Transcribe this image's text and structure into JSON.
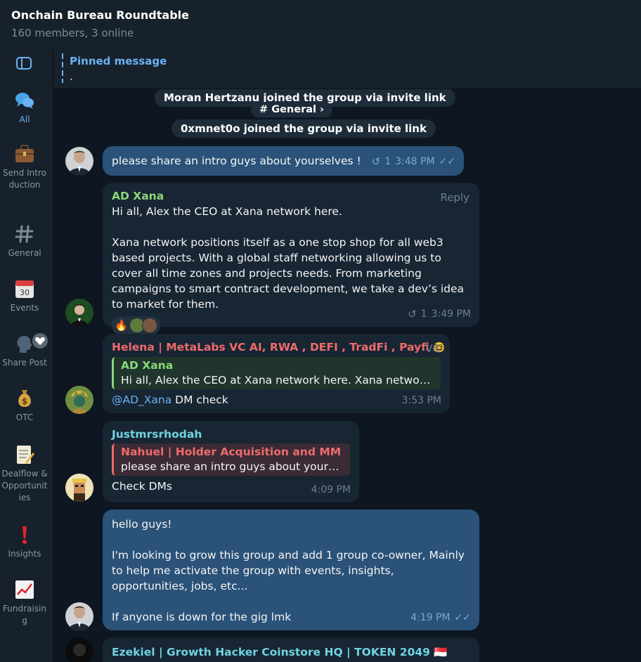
{
  "header": {
    "title": "Onchain Bureau Roundtable",
    "subtitle": "160 members, 3 online"
  },
  "sidebar": {
    "items": [
      {
        "label": "All",
        "icon": "chat-bubbles-icon"
      },
      {
        "label": "Send Introduction",
        "icon": "briefcase-icon"
      },
      {
        "label": "General",
        "icon": "hash-icon"
      },
      {
        "label": "Events",
        "icon": "calendar-icon"
      },
      {
        "label": "Share Post",
        "icon": "speaking-head-icon"
      },
      {
        "label": "OTC",
        "icon": "money-bag-icon"
      },
      {
        "label": "Dealflow & Opportunities",
        "icon": "memo-icon"
      },
      {
        "label": "Insights",
        "icon": "exclamation-icon"
      },
      {
        "label": "Fundraising",
        "icon": "chart-increasing-icon"
      }
    ]
  },
  "pinned": {
    "title": "Pinned message",
    "text": "."
  },
  "service": {
    "join1": "Moran Hertzanu joined the group via invite link",
    "topic": "# General ›",
    "join2": "0xmnet0o joined the group via invite link"
  },
  "messages": {
    "m1": {
      "text": "please share an intro guys about yourselves !",
      "replies": "1",
      "time": "3:48 PM"
    },
    "m2": {
      "sender": "AD Xana",
      "reply_label": "Reply",
      "line1": "Hi all, Alex the CEO at Xana network here.",
      "line2": "Xana network positions itself as a one stop shop for all web3 based projects. With a global staff networking allowing us to cover all time zones and projects needs. From marketing campaigns to smart contract development, we take a dev’s idea to market for them.",
      "reaction": "🔥",
      "replies": "1",
      "time": "3:49 PM"
    },
    "m3": {
      "sender": "Helena | MetaLabs VC AI, RWA , DEFI , TradFi , Payfi",
      "sender_emoji": "🤓",
      "tag": "VC",
      "quote_name": "AD Xana",
      "quote_text": "Hi all, Alex the CEO at Xana network here.   Xana network …",
      "mention": "@AD_Xana",
      "text": " DM check",
      "time": "3:53 PM"
    },
    "m4": {
      "sender": "Justmrsrhodah",
      "quote_name": "Nahuel | Holder Acquisition and MM",
      "quote_text": "please share an intro guys about yourse…",
      "text": "Check DMs",
      "time": "4:09 PM"
    },
    "m5": {
      "p1": "hello guys!",
      "p2": "I'm looking to grow this group and add 1 group co-owner, Mainly to help me activate the group with events, insights, opportunities, jobs, etc...",
      "p3": "If anyone is down for the gig lmk",
      "time": "4:19 PM"
    },
    "m6": {
      "sender": "Ezekiel | Growth Hacker Coinstore HQ | TOKEN 2049",
      "sender_emoji": "🇸🇬"
    }
  },
  "colors": {
    "background": "#0e1621",
    "panel": "#17212b",
    "incoming_bubble": "#182533",
    "outgoing_bubble": "#2b5278",
    "accent": "#6ab2f2",
    "sender_green": "#8bd87a",
    "sender_red": "#ee6b6b",
    "sender_cyan": "#6fd3e0"
  }
}
